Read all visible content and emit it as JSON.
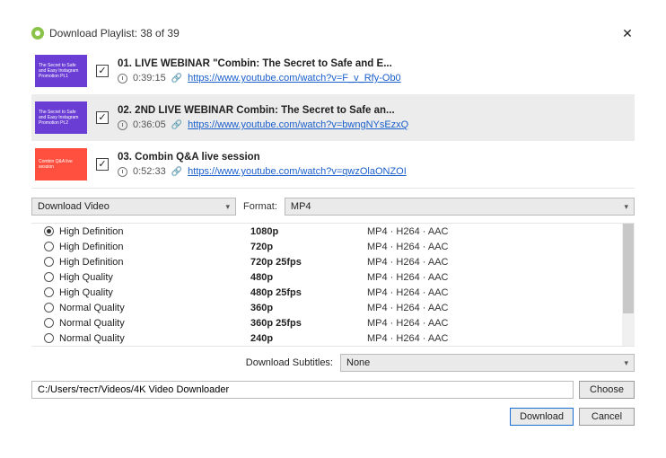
{
  "window": {
    "title": "Download Playlist: 38 of 39"
  },
  "playlist": [
    {
      "checked": true,
      "thumb_color": "purple",
      "thumb_text": "The Secret to Safe and Easy Instagram Promotion Pt.1",
      "title": "01. LIVE WEBINAR \"Combin: The Secret to Safe and E...",
      "duration": "0:39:15",
      "url": "https://www.youtube.com/watch?v=F_v_Rfy-Ob0"
    },
    {
      "checked": true,
      "thumb_color": "purple",
      "thumb_text": "The Secret to Safe and Easy Instagram Promotion Pt.2",
      "title": "02. 2ND LIVE WEBINAR Combin: The Secret to Safe an...",
      "duration": "0:36:05",
      "url": "https://www.youtube.com/watch?v=bwngNYsEzxQ"
    },
    {
      "checked": true,
      "thumb_color": "red",
      "thumb_text": "Combin Q&A live session",
      "title": "03. Combin Q&A live session",
      "duration": "0:52:33",
      "url": "https://www.youtube.com/watch?v=qwzOlaONZOI"
    }
  ],
  "action_select": "Download Video",
  "format_label": "Format:",
  "format_value": "MP4",
  "formats": [
    {
      "selected": true,
      "quality": "High Definition",
      "res": "1080p",
      "codec": "MP4 · H264 · AAC"
    },
    {
      "selected": false,
      "quality": "High Definition",
      "res": "720p",
      "codec": "MP4 · H264 · AAC"
    },
    {
      "selected": false,
      "quality": "High Definition",
      "res": "720p 25fps",
      "codec": "MP4 · H264 · AAC"
    },
    {
      "selected": false,
      "quality": "High Quality",
      "res": "480p",
      "codec": "MP4 · H264 · AAC"
    },
    {
      "selected": false,
      "quality": "High Quality",
      "res": "480p 25fps",
      "codec": "MP4 · H264 · AAC"
    },
    {
      "selected": false,
      "quality": "Normal Quality",
      "res": "360p",
      "codec": "MP4 · H264 · AAC"
    },
    {
      "selected": false,
      "quality": "Normal Quality",
      "res": "360p 25fps",
      "codec": "MP4 · H264 · AAC"
    },
    {
      "selected": false,
      "quality": "Normal Quality",
      "res": "240p",
      "codec": "MP4 · H264 · AAC"
    }
  ],
  "subtitles_label": "Download Subtitles:",
  "subtitles_value": "None",
  "save_path": "C:/Users/тест/Videos/4K Video Downloader",
  "buttons": {
    "choose": "Choose",
    "download": "Download",
    "cancel": "Cancel"
  }
}
